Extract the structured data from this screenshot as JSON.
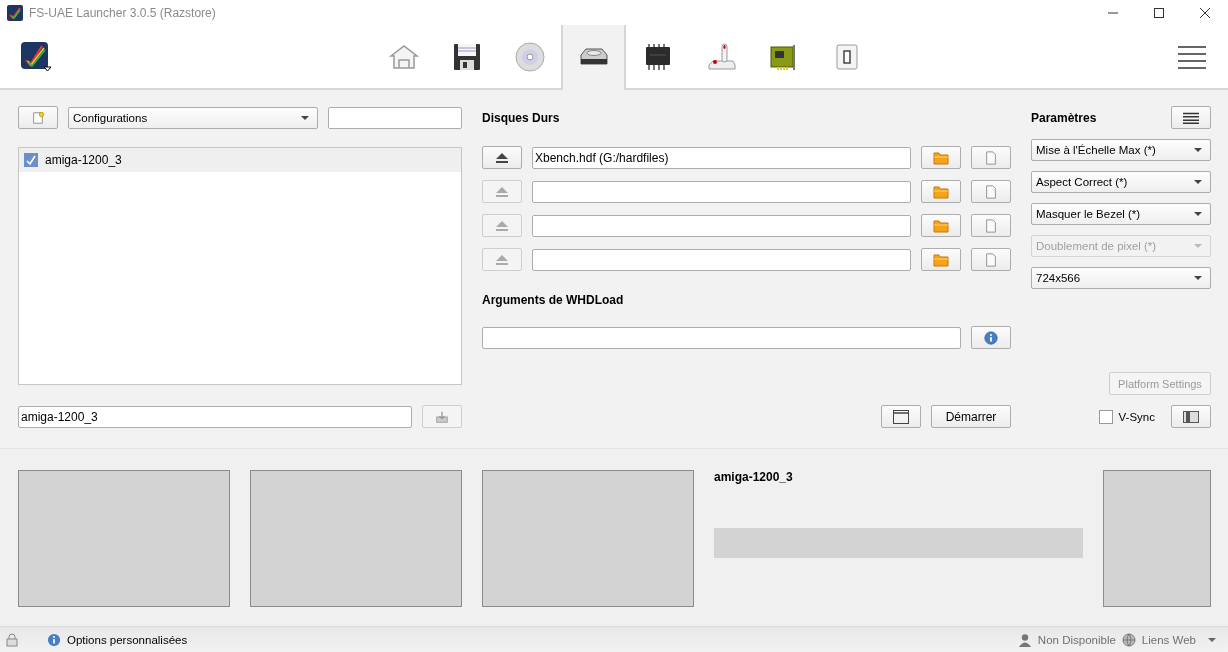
{
  "window": {
    "title": "FS-UAE Launcher 3.0.5 (Razstore)"
  },
  "tabs": [
    {
      "kind": "home",
      "selected": false
    },
    {
      "kind": "floppy",
      "selected": false
    },
    {
      "kind": "cdrom",
      "selected": false
    },
    {
      "kind": "harddisk",
      "selected": true
    },
    {
      "kind": "chip",
      "selected": false
    },
    {
      "kind": "joystick",
      "selected": false
    },
    {
      "kind": "card",
      "selected": false
    },
    {
      "kind": "switch",
      "selected": false
    }
  ],
  "configs": {
    "dropdown": "Configurations",
    "list": [
      {
        "name": "amiga-1200_3",
        "selected": true
      }
    ],
    "config_name": "amiga-1200_3"
  },
  "hard_drives": {
    "title": "Disques Durs",
    "slots": [
      {
        "value": "Xbench.hdf (G:/hardfiles)",
        "disabled": false
      },
      {
        "disabled": true
      },
      {
        "disabled": true
      },
      {
        "disabled": true
      }
    ]
  },
  "whdload": {
    "title": "Arguments de WHDLoad"
  },
  "start_button": "Démarrer",
  "settings": {
    "title": "Paramètres",
    "options": [
      {
        "value": "Mise à l'Échelle Max (*)",
        "disabled": false
      },
      {
        "value": "Aspect Correct (*)",
        "disabled": false
      },
      {
        "value": "Masquer le Bezel (*)",
        "disabled": false
      },
      {
        "value": "Doublement de pixel (*)",
        "disabled": true
      },
      {
        "value": "724x566",
        "disabled": false
      }
    ],
    "platform_settings": {
      "label": "Platform Settings",
      "disabled": true
    },
    "vsync": {
      "label": "V-Sync",
      "checked": false
    }
  },
  "preview": {
    "title": "amiga-1200_3"
  },
  "status_bar": {
    "message": "Options personnalisées",
    "user": "Non Disponible",
    "links": "Liens Web"
  }
}
